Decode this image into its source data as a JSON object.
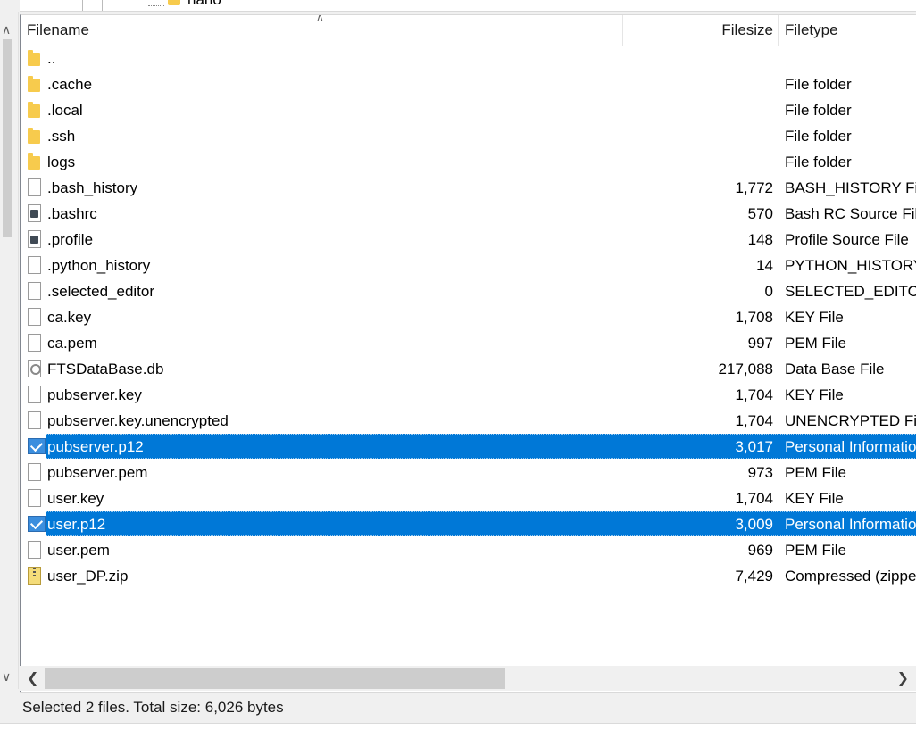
{
  "tree": {
    "partial_label": "nano"
  },
  "columns": {
    "name": "Filename",
    "size": "Filesize",
    "type": "Filetype"
  },
  "files": [
    {
      "name": "..",
      "size": "",
      "type": "",
      "icon": "folder-icon",
      "selected": false
    },
    {
      "name": ".cache",
      "size": "",
      "type": "File folder",
      "icon": "folder-icon",
      "selected": false
    },
    {
      "name": ".local",
      "size": "",
      "type": "File folder",
      "icon": "folder-icon",
      "selected": false
    },
    {
      "name": ".ssh",
      "size": "",
      "type": "File folder",
      "icon": "folder-icon",
      "selected": false
    },
    {
      "name": "logs",
      "size": "",
      "type": "File folder",
      "icon": "folder-icon",
      "selected": false
    },
    {
      "name": ".bash_history",
      "size": "1,772",
      "type": "BASH_HISTORY File",
      "icon": "file-icon",
      "selected": false
    },
    {
      "name": ".bashrc",
      "size": "570",
      "type": "Bash RC Source File",
      "icon": "script-file-icon",
      "selected": false
    },
    {
      "name": ".profile",
      "size": "148",
      "type": "Profile Source File",
      "icon": "script-file-icon",
      "selected": false
    },
    {
      "name": ".python_history",
      "size": "14",
      "type": "PYTHON_HISTORY File",
      "icon": "file-icon",
      "selected": false
    },
    {
      "name": ".selected_editor",
      "size": "0",
      "type": "SELECTED_EDITOR File",
      "icon": "file-icon",
      "selected": false
    },
    {
      "name": "ca.key",
      "size": "1,708",
      "type": "KEY File",
      "icon": "file-icon",
      "selected": false
    },
    {
      "name": "ca.pem",
      "size": "997",
      "type": "PEM File",
      "icon": "file-icon",
      "selected": false
    },
    {
      "name": "FTSDataBase.db",
      "size": "217,088",
      "type": "Data Base File",
      "icon": "database-file-icon",
      "selected": false
    },
    {
      "name": "pubserver.key",
      "size": "1,704",
      "type": "KEY File",
      "icon": "file-icon",
      "selected": false
    },
    {
      "name": "pubserver.key.unencrypted",
      "size": "1,704",
      "type": "UNENCRYPTED File",
      "icon": "file-icon",
      "selected": false
    },
    {
      "name": "pubserver.p12",
      "size": "3,017",
      "type": "Personal Information Exchange",
      "icon": "certificate-icon",
      "selected": true
    },
    {
      "name": "pubserver.pem",
      "size": "973",
      "type": "PEM File",
      "icon": "file-icon",
      "selected": false
    },
    {
      "name": "user.key",
      "size": "1,704",
      "type": "KEY File",
      "icon": "file-icon",
      "selected": false
    },
    {
      "name": "user.p12",
      "size": "3,009",
      "type": "Personal Information Exchange",
      "icon": "certificate-icon",
      "selected": true
    },
    {
      "name": "user.pem",
      "size": "969",
      "type": "PEM File",
      "icon": "file-icon",
      "selected": false
    },
    {
      "name": "user_DP.zip",
      "size": "7,429",
      "type": "Compressed (zipped) Folder",
      "icon": "zip-file-icon",
      "selected": false
    }
  ],
  "status": {
    "text": "Selected 2 files. Total size: 6,026 bytes"
  },
  "colors": {
    "selection": "#0078d7",
    "folder": "#f7cb4d"
  }
}
